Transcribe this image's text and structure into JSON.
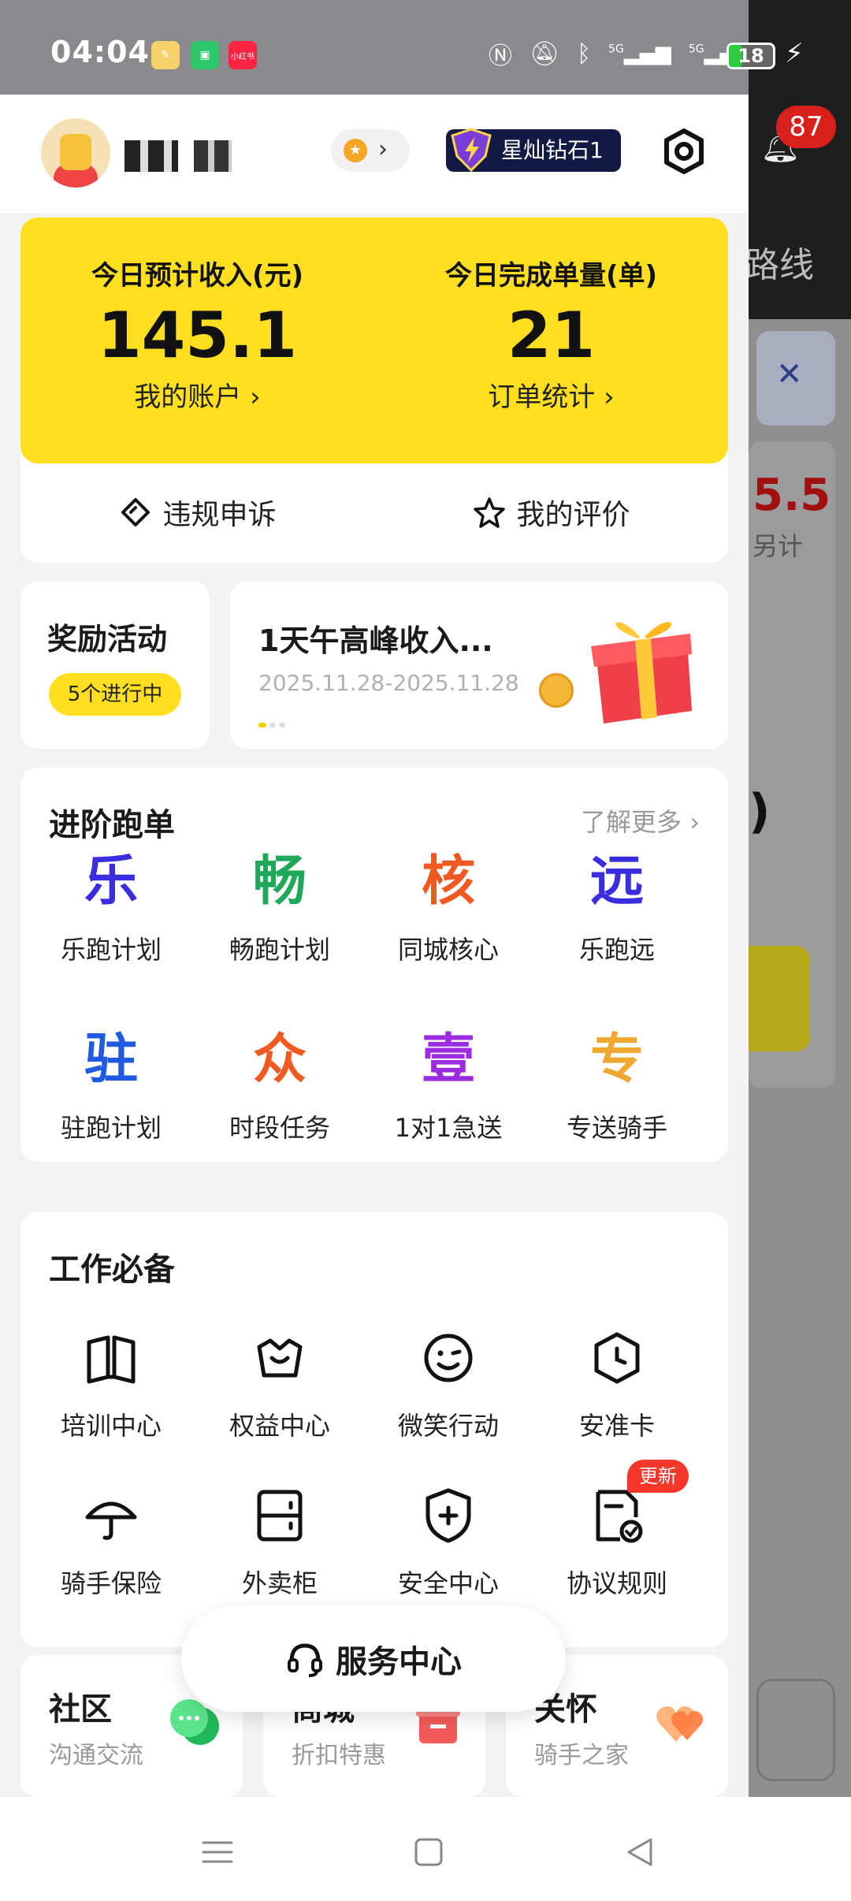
{
  "status_bar": {
    "time": "04:04",
    "apps": [
      "小红书"
    ],
    "battery": "18",
    "network": [
      "5G",
      "5G"
    ]
  },
  "header": {
    "vip_label": "星灿钻石1"
  },
  "earnings": {
    "income_label": "今日预计收入(元)",
    "income_value": "145.1",
    "income_link": "我的账户 ›",
    "orders_label": "今日完成单量(单)",
    "orders_value": "21",
    "orders_link": "订单统计 ›",
    "appeal_label": "违规申诉",
    "rating_label": "我的评价"
  },
  "rewards": {
    "title": "奖励活动",
    "badge": "5个进行中",
    "banner_title": "1天午高峰收入...",
    "banner_date": "2025.11.28-2025.11.28"
  },
  "advanced": {
    "title": "进阶跑单",
    "more": "了解更多 ›",
    "items": [
      {
        "glyph": "乐",
        "label": "乐跑计划",
        "color": "#3a2de0"
      },
      {
        "glyph": "畅",
        "label": "畅跑计划",
        "color": "#1fa85a"
      },
      {
        "glyph": "核",
        "label": "同城核心",
        "color": "#f05a22"
      },
      {
        "glyph": "远",
        "label": "乐跑远",
        "color": "#3a2de0"
      },
      {
        "glyph": "驻",
        "label": "驻跑计划",
        "color": "#1f5ae0"
      },
      {
        "glyph": "众",
        "label": "时段任务",
        "color": "#f05a22"
      },
      {
        "glyph": "壹",
        "label": "1对1急送",
        "color": "#9b2de0"
      },
      {
        "glyph": "专",
        "label": "专送骑手",
        "color": "#f0a830"
      }
    ]
  },
  "essentials": {
    "title": "工作必备",
    "items": [
      {
        "icon": "book-icon",
        "label": "培训中心"
      },
      {
        "icon": "crown-icon",
        "label": "权益中心"
      },
      {
        "icon": "wink-smile-icon",
        "label": "微笑行动"
      },
      {
        "icon": "clock-hexagon-icon",
        "label": "安准卡"
      },
      {
        "icon": "umbrella-icon",
        "label": "骑手保险"
      },
      {
        "icon": "locker-icon",
        "label": "外卖柜"
      },
      {
        "icon": "shield-plus-icon",
        "label": "安全中心"
      },
      {
        "icon": "document-check-icon",
        "label": "协议规则",
        "badge": "更新"
      }
    ]
  },
  "bottom_cards": [
    {
      "title": "社区",
      "subtitle": "沟通交流",
      "icon": "chat-bubbles-icon"
    },
    {
      "title": "商城",
      "subtitle": "折扣特惠",
      "icon": "gift-box-icon"
    },
    {
      "title": "关怀",
      "subtitle": "骑手之家",
      "icon": "hearts-icon"
    }
  ],
  "service_center": {
    "label": "服务中心",
    "icon": "headset-icon"
  },
  "background_app": {
    "badge_count": "87",
    "route_text": "路线",
    "price_text": "5.5",
    "extra_text": "另计"
  },
  "colors": {
    "accent_yellow": "#ffdf1f",
    "vip_bg": "#121a44",
    "badge_red": "#f5372b"
  }
}
